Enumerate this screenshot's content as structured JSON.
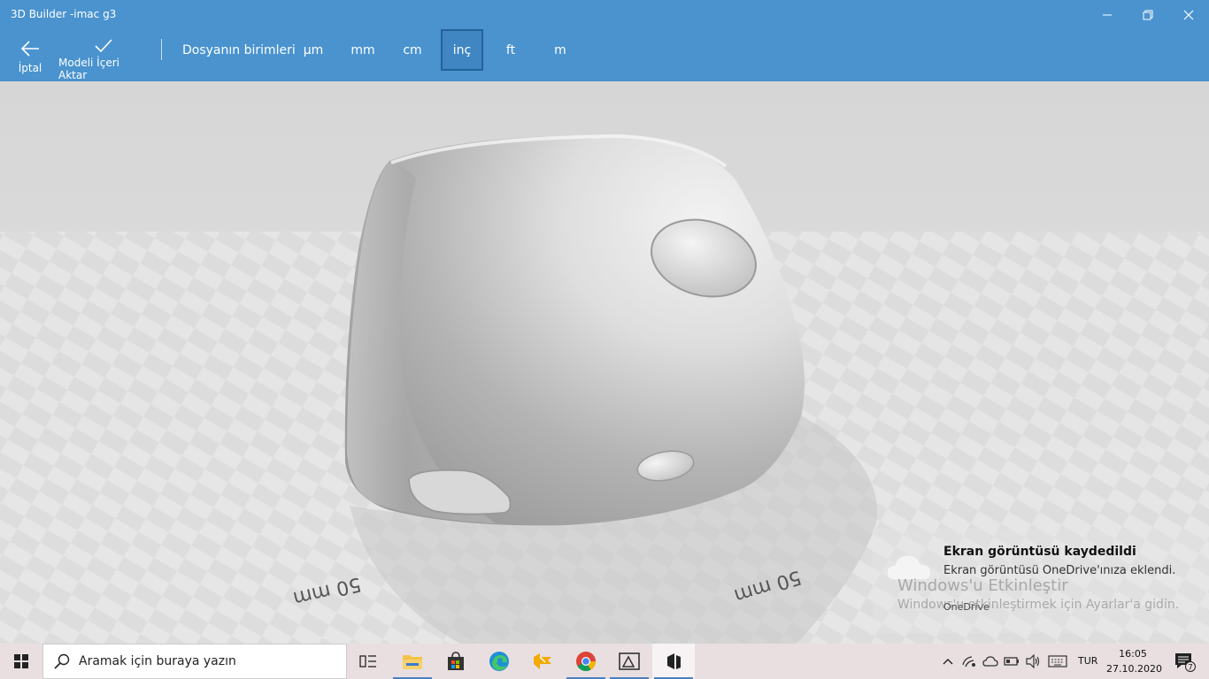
{
  "window": {
    "title": "3D Builder -imac g3"
  },
  "commands": {
    "cancel_label": "İptal",
    "import_label": "Modeli İçeri Aktar"
  },
  "units": {
    "label": "Dosyanın birimleri",
    "options": [
      "µm",
      "mm",
      "cm",
      "inç",
      "ft",
      "m"
    ],
    "selected": "inç"
  },
  "viewport": {
    "scale_left": "50 mm",
    "scale_right": "50 mm"
  },
  "toast": {
    "title": "Ekran görüntüsü kaydedildi",
    "body": "Ekran görüntüsü OneDrive'ınıza eklendi.",
    "source": "OneDrive"
  },
  "watermark": {
    "line1": "Windows'u Etkinleştir",
    "line2": "Windows'u etkinleştirmek için Ayarlar'a gidin."
  },
  "taskbar": {
    "search_placeholder": "Aramak için buraya yazın",
    "language": "TUR",
    "time": "16:05",
    "date": "27.10.2020",
    "notification_count": "7"
  },
  "colors": {
    "accent": "#4a93cf",
    "selected_border": "#24639a"
  }
}
